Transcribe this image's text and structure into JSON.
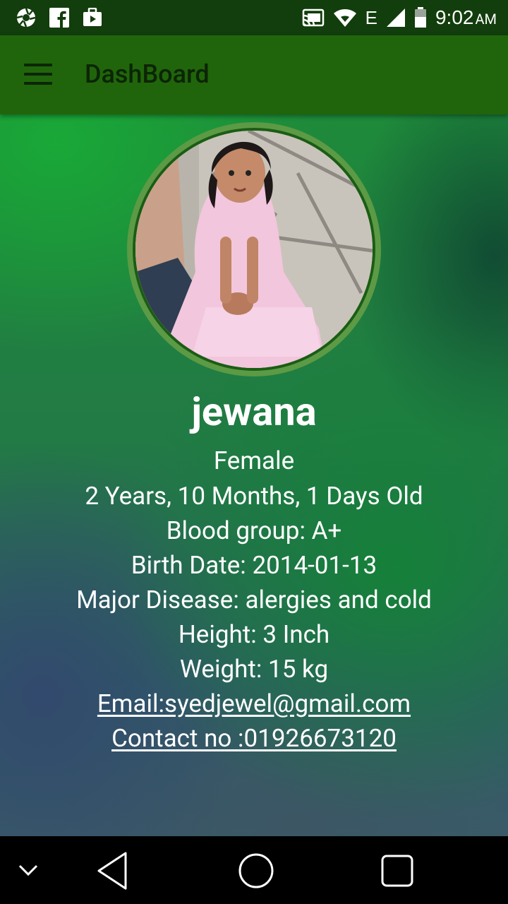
{
  "status_bar": {
    "time": "9:02",
    "ampm": "AM",
    "network": "E",
    "left_icons": [
      "aperture-icon",
      "facebook-icon",
      "briefcase-icon"
    ],
    "right_icons": [
      "cast-icon",
      "wifi-icon",
      "signal-icon",
      "battery-icon"
    ]
  },
  "app_bar": {
    "title": "DashBoard",
    "menu_icon": "menu-icon",
    "color": "#20650b"
  },
  "profile": {
    "name": "jewana",
    "gender": "Female",
    "age": "2 Years, 10 Months, 1 Days Old",
    "blood_group": "Blood group: A+",
    "birth_date": "Birth Date: 2014-01-13",
    "major_disease": "Major Disease: alergies and cold",
    "height": "Height: 3 Inch",
    "weight": "Weight: 15 kg",
    "email": "Email:syedjewel@gmail.com",
    "contact": "Contact no :01926673120"
  },
  "nav_bar": {
    "buttons": [
      "collapse-icon",
      "back-icon",
      "home-icon",
      "recents-icon"
    ]
  }
}
